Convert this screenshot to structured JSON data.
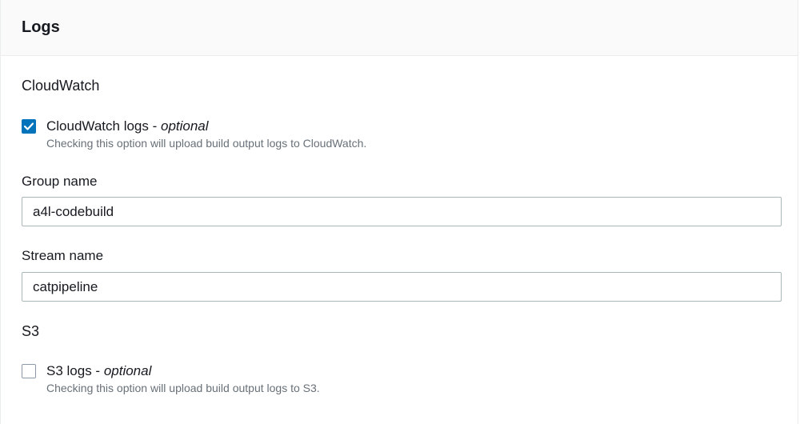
{
  "panel": {
    "title": "Logs"
  },
  "cloudwatch": {
    "section_label": "CloudWatch",
    "checkbox": {
      "label": "CloudWatch logs",
      "separator": " - ",
      "optional": "optional",
      "description": "Checking this option will upload build output logs to CloudWatch.",
      "checked": true
    },
    "group_name": {
      "label": "Group name",
      "value": "a4l-codebuild"
    },
    "stream_name": {
      "label": "Stream name",
      "value": "catpipeline"
    }
  },
  "s3": {
    "section_label": "S3",
    "checkbox": {
      "label": "S3 logs",
      "separator": " - ",
      "optional": "optional",
      "description": "Checking this option will upload build output logs to S3.",
      "checked": false
    }
  },
  "colors": {
    "accent": "#0073bb",
    "header_bg": "#fafafa",
    "muted_text": "#687078"
  }
}
